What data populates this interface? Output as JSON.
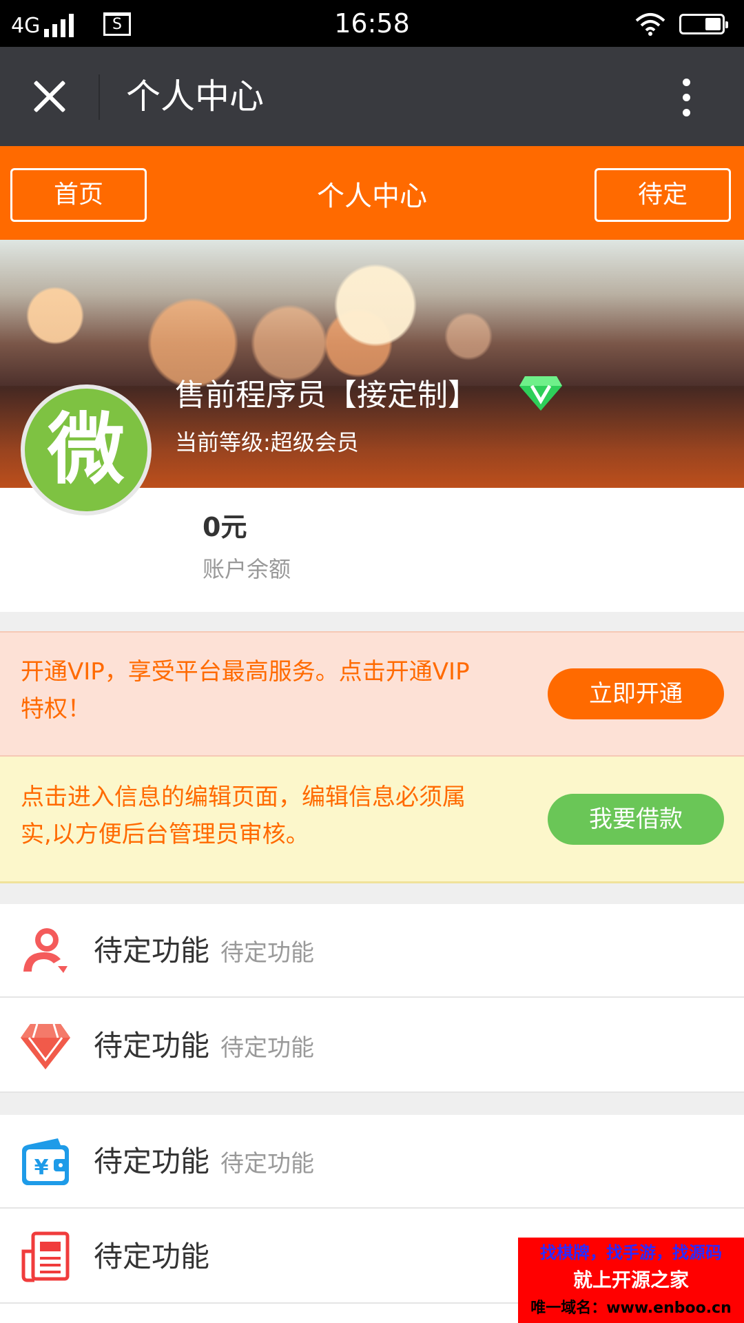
{
  "status_bar": {
    "network": "4G",
    "sim_label": "S",
    "time": "16:58"
  },
  "title_bar": {
    "title": "个人中心"
  },
  "nav": {
    "home_label": "首页",
    "title": "个人中心",
    "pending_label": "待定"
  },
  "profile": {
    "avatar_text": "微",
    "name": "售前程序员【接定制】",
    "level": "当前等级:超级会员",
    "balance_value": "0元",
    "balance_label": "账户余额"
  },
  "vip_notice": {
    "text": "开通VIP，享受平台最高服务。点击开通VIP特权！",
    "button": "立即开通",
    "color": "#ff6a00"
  },
  "loan_notice": {
    "text": "点击进入信息的编辑页面，编辑信息必须属实,以方便后台管理员审核。",
    "button": "我要借款",
    "color": "#6ac657"
  },
  "menu": {
    "items": [
      {
        "icon": "user-icon",
        "title": "待定功能",
        "subtitle": "待定功能"
      },
      {
        "icon": "diamond-icon",
        "title": "待定功能",
        "subtitle": "待定功能"
      },
      {
        "icon": "wallet-icon",
        "title": "待定功能",
        "subtitle": "待定功能"
      },
      {
        "icon": "document-icon",
        "title": "待定功能",
        "subtitle": ""
      }
    ]
  },
  "watermark": {
    "line1": "找棋牌，找手游，找源码",
    "line2": "就上开源之家",
    "line3": "唯一域名：www.enboo.cn"
  },
  "colors": {
    "accent": "#ff6a00",
    "title_bar": "#393a3f",
    "avatar_bg": "#7ec242"
  }
}
